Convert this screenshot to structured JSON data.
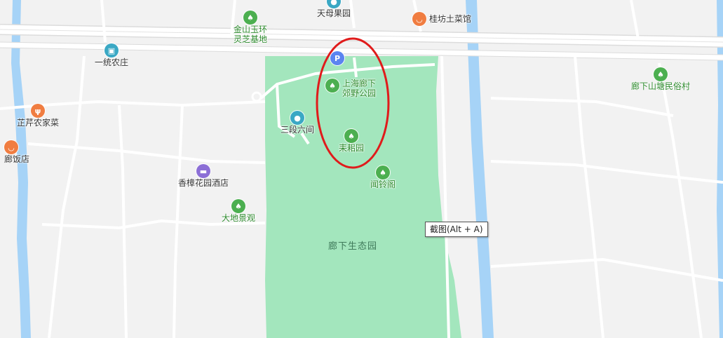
{
  "colors": {
    "background": "#f2f2f2",
    "park": "#a3e6bd",
    "water": "#a6d3f7",
    "road": "#ffffff",
    "road_border": "#dcdcdc",
    "annotation": "#e01b1b",
    "green_poi": "#4caf50",
    "blue_poi": "#3aa8c4",
    "orange_poi": "#f07d41",
    "purple_poi": "#8c6fd6",
    "parking": "#5b84f0",
    "green_text": "#2e8b2e",
    "dark_text": "#333333",
    "park_text": "#3f7a5a"
  },
  "pois": [
    {
      "id": "tianmu",
      "label": "天母果园",
      "icon": "map-pin-icon",
      "type": "blue"
    },
    {
      "id": "guifang",
      "label": "桂坊土菜馆",
      "icon": "restaurant-icon",
      "type": "orange"
    },
    {
      "id": "jinshan",
      "label": "金山玉环\n灵芝基地",
      "icon": "tree-icon",
      "type": "green"
    },
    {
      "id": "yitong",
      "label": "一统农庄",
      "icon": "building-icon",
      "type": "blue"
    },
    {
      "id": "langxia_village",
      "label": "廊下山塘民俗村",
      "icon": "tree-icon",
      "type": "green"
    },
    {
      "id": "qiqin",
      "label": "芷芹农家菜",
      "icon": "restaurant-icon",
      "type": "orange"
    },
    {
      "id": "langfandian",
      "label": "廊饭店",
      "icon": "restaurant-icon",
      "type": "orange"
    },
    {
      "id": "parking",
      "label": "",
      "icon": "parking-icon",
      "type": "parking"
    },
    {
      "id": "shanghai_park",
      "label": "上海廊下\n郊野公园",
      "icon": "tree-icon",
      "type": "green"
    },
    {
      "id": "sanduan",
      "label": "三段六间",
      "icon": "map-pin-icon",
      "type": "blue"
    },
    {
      "id": "modao",
      "label": "耒耜园",
      "icon": "tree-icon",
      "type": "green"
    },
    {
      "id": "wenling",
      "label": "闻铃阁",
      "icon": "tree-icon",
      "type": "green"
    },
    {
      "id": "xiangzhang",
      "label": "香樟花园酒店",
      "icon": "hotel-icon",
      "type": "purple"
    },
    {
      "id": "dadi",
      "label": "大地景观",
      "icon": "tree-icon",
      "type": "green"
    }
  ],
  "area_label": "廊下生态园",
  "tooltip": "截图(Alt + A)"
}
